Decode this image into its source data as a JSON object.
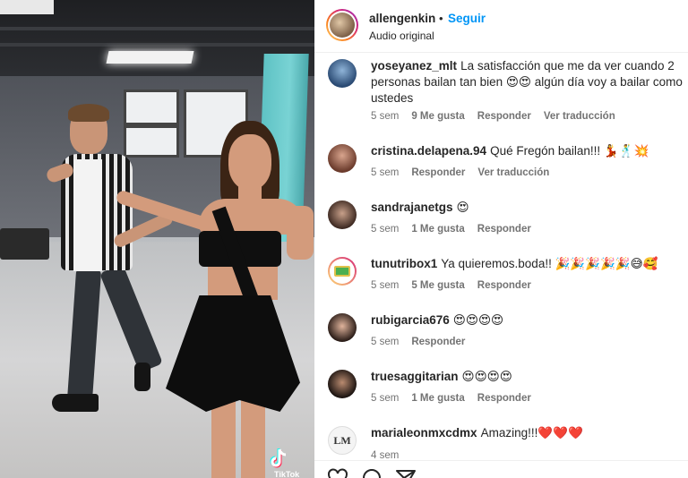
{
  "header": {
    "username": "allengenkin",
    "separator": "•",
    "follow_label": "Seguir",
    "audio_label": "Audio original"
  },
  "video": {
    "watermark": "TikTok"
  },
  "comments": [
    {
      "username": "yoseyanez_mlt",
      "text": "La satisfacción que me da ver cuando 2 personas bailan tan bien 😍😍 algún día voy a bailar como ustedes",
      "time": "5 sem",
      "likes": "9 Me gusta",
      "reply": "Responder",
      "translate": "Ver traducción"
    },
    {
      "username": "cristina.delapena.94",
      "text": "Qué Fregón bailan!!! 💃🕺💥",
      "time": "5 sem",
      "likes": "",
      "reply": "Responder",
      "translate": "Ver traducción"
    },
    {
      "username": "sandrajanetgs",
      "text": "😍",
      "time": "5 sem",
      "likes": "1 Me gusta",
      "reply": "Responder",
      "translate": ""
    },
    {
      "username": "tunutribox1",
      "text": "Ya quieremos.boda!! 🎉🎉🎉🎉🎉😅🥰",
      "time": "5 sem",
      "likes": "5 Me gusta",
      "reply": "Responder",
      "translate": ""
    },
    {
      "username": "rubigarcia676",
      "text": "😍😍😍😍",
      "time": "5 sem",
      "likes": "",
      "reply": "Responder",
      "translate": ""
    },
    {
      "username": "truesaggitarian",
      "text": "😍😍😍😍",
      "time": "5 sem",
      "likes": "1 Me gusta",
      "reply": "Responder",
      "translate": ""
    },
    {
      "username": "marialeonmxcdmx",
      "text": "Amazing!!!❤️❤️❤️",
      "time": "4 sem",
      "likes": "",
      "reply": "",
      "translate": ""
    }
  ],
  "colors": {
    "accent": "#0095f6",
    "muted": "#737373",
    "text": "#262626"
  },
  "icons": [
    "heart-icon",
    "comment-icon",
    "share-icon"
  ]
}
